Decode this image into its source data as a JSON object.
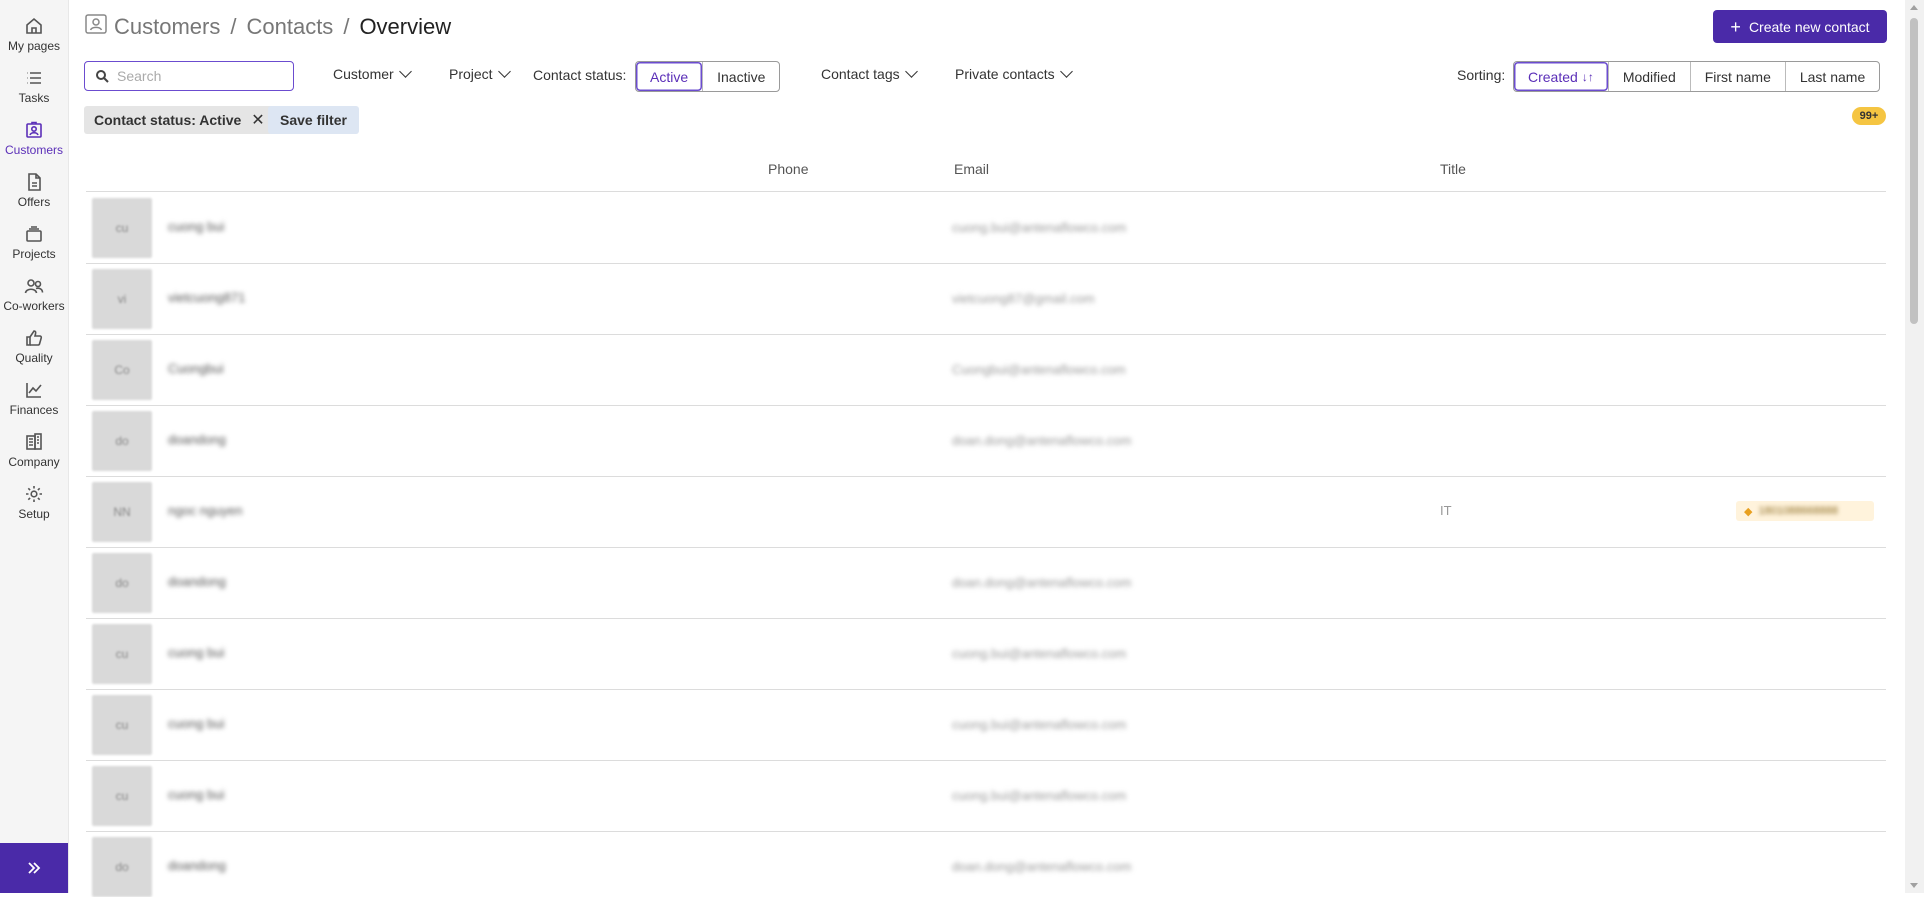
{
  "sidebar": {
    "items": [
      {
        "label": "My pages",
        "icon": "home-icon"
      },
      {
        "label": "Tasks",
        "icon": "list-icon"
      },
      {
        "label": "Customers",
        "icon": "contact-card-icon"
      },
      {
        "label": "Offers",
        "icon": "document-icon"
      },
      {
        "label": "Projects",
        "icon": "folder-stack-icon"
      },
      {
        "label": "Co-workers",
        "icon": "people-icon"
      },
      {
        "label": "Quality",
        "icon": "thumbs-up-icon"
      },
      {
        "label": "Finances",
        "icon": "line-chart-icon"
      },
      {
        "label": "Company",
        "icon": "building-icon"
      },
      {
        "label": "Setup",
        "icon": "gear-icon"
      }
    ],
    "active_item": "Customers"
  },
  "header": {
    "breadcrumb": [
      "Customers",
      "Contacts",
      "Overview"
    ],
    "create_button": "Create new contact"
  },
  "filters": {
    "search_placeholder": "Search",
    "customer": "Customer",
    "project": "Project",
    "contact_status_label": "Contact status:",
    "status_options": [
      "Active",
      "Inactive"
    ],
    "status_selected": "Active",
    "contact_tags": "Contact tags",
    "private_contacts": "Private contacts",
    "sorting_label": "Sorting:",
    "sorting_options": [
      "Created",
      "Modified",
      "First name",
      "Last name"
    ],
    "sorting_selected": "Created",
    "active_filter_chip": "Contact status: Active",
    "save_filter": "Save filter",
    "count_badge": "99+"
  },
  "table": {
    "columns": [
      "Phone",
      "Email",
      "Title"
    ],
    "rows": [
      {
        "initials": "cu",
        "name": "cuong bui",
        "email": "cuong.bui@antenaflowco.com",
        "title": "",
        "tag": ""
      },
      {
        "initials": "vi",
        "name": "vietcuong871",
        "email": "vietcuong87@gmail.com",
        "title": "",
        "tag": ""
      },
      {
        "initials": "Co",
        "name": "Cuongbui",
        "email": "Cuongbui@antenaflowco.com",
        "title": "",
        "tag": ""
      },
      {
        "initials": "do",
        "name": "doandong",
        "email": "doan.dong@antenaflowco.com",
        "title": "",
        "tag": ""
      },
      {
        "initials": "NN",
        "name": "ngoc nguyen",
        "email": "",
        "title": "IT",
        "tag": "1801088668888"
      },
      {
        "initials": "do",
        "name": "doandong",
        "email": "doan.dong@antenaflowco.com",
        "title": "",
        "tag": ""
      },
      {
        "initials": "cu",
        "name": "cuong bui",
        "email": "cuong.bui@antenaflowco.com",
        "title": "",
        "tag": ""
      },
      {
        "initials": "cu",
        "name": "cuong bui",
        "email": "cuong.bui@antenaflowco.com",
        "title": "",
        "tag": ""
      },
      {
        "initials": "cu",
        "name": "cuong bui",
        "email": "cuong.bui@antenaflowco.com",
        "title": "",
        "tag": ""
      },
      {
        "initials": "do",
        "name": "doandong",
        "email": "doan.dong@antenaflowco.com",
        "title": "",
        "tag": ""
      }
    ]
  },
  "colors": {
    "brand": "#4a2aa8",
    "accent": "#6b4ccf",
    "badge": "#f5c542",
    "tag_bg": "#fff3dc"
  }
}
